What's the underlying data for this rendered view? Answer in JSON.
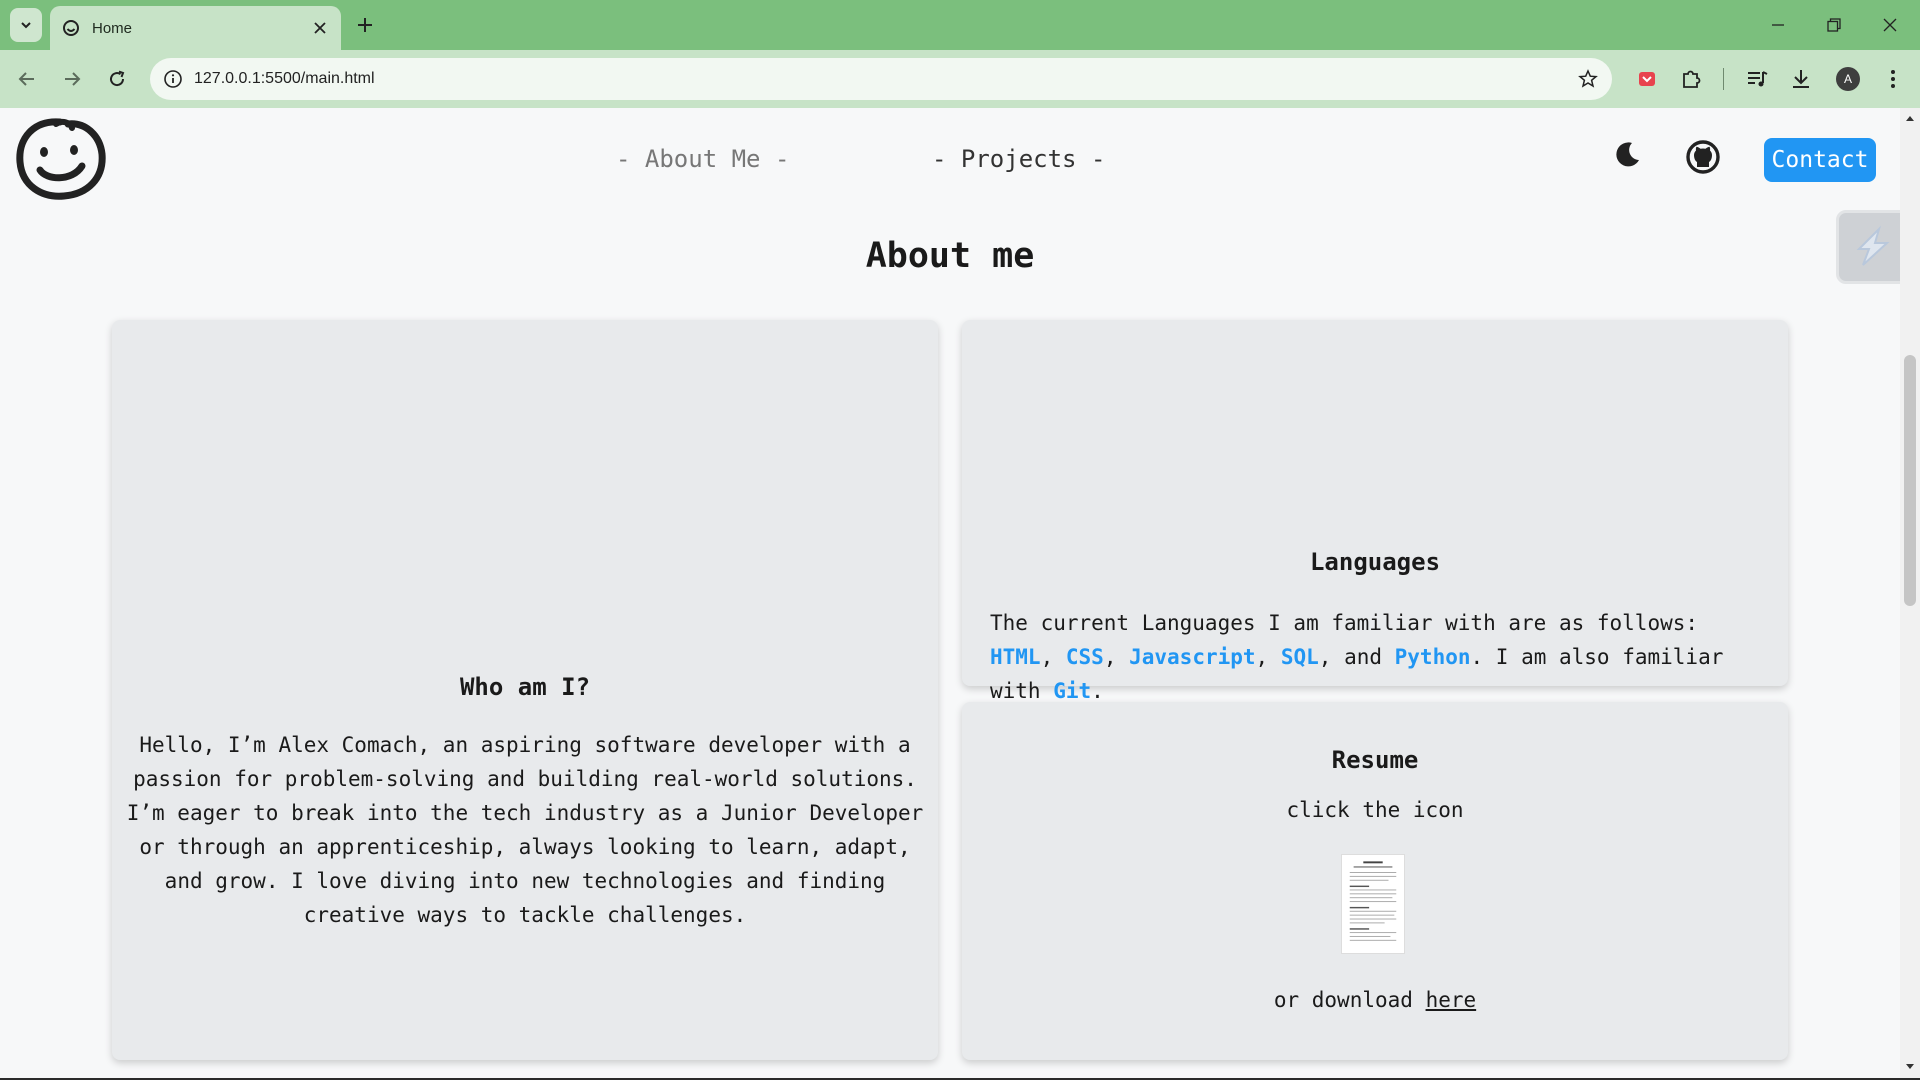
{
  "browser": {
    "tab_title": "Home",
    "url": "127.0.0.1:5500/main.html",
    "profile_initial": "A"
  },
  "nav": {
    "about_label": "- About Me -",
    "projects_label": "- Projects -",
    "contact_label": "Contact"
  },
  "main": {
    "heading": "About me",
    "who": {
      "title": "Who am I?",
      "text": "Hello, I’m Alex Comach, an aspiring software developer with a passion for problem-solving and building real-world solutions. I’m eager to break into the tech industry as a Junior Developer or through an apprenticeship, always looking to learn, adapt, and grow. I love diving into new technologies and finding creative ways to tackle challenges."
    },
    "languages": {
      "title": "Languages",
      "intro": "The current Languages I am familiar with are as follows: ",
      "items": [
        "HTML",
        "CSS",
        "Javascript",
        "SQL",
        "Python"
      ],
      "sep1": ", ",
      "sep2": ", ",
      "sep3": ", ",
      "sep4": ", and ",
      "mid": ". I am also familiar with ",
      "extra": "Git",
      "end": "."
    },
    "resume": {
      "title": "Resume",
      "subtitle": "click the icon",
      "download_prefix": "or download ",
      "download_link": "here"
    }
  },
  "colors": {
    "tabbar": "#7bbf7d",
    "toolbar": "#c7e3c7",
    "accent": "#2196f3",
    "card": "#e8eaec"
  }
}
